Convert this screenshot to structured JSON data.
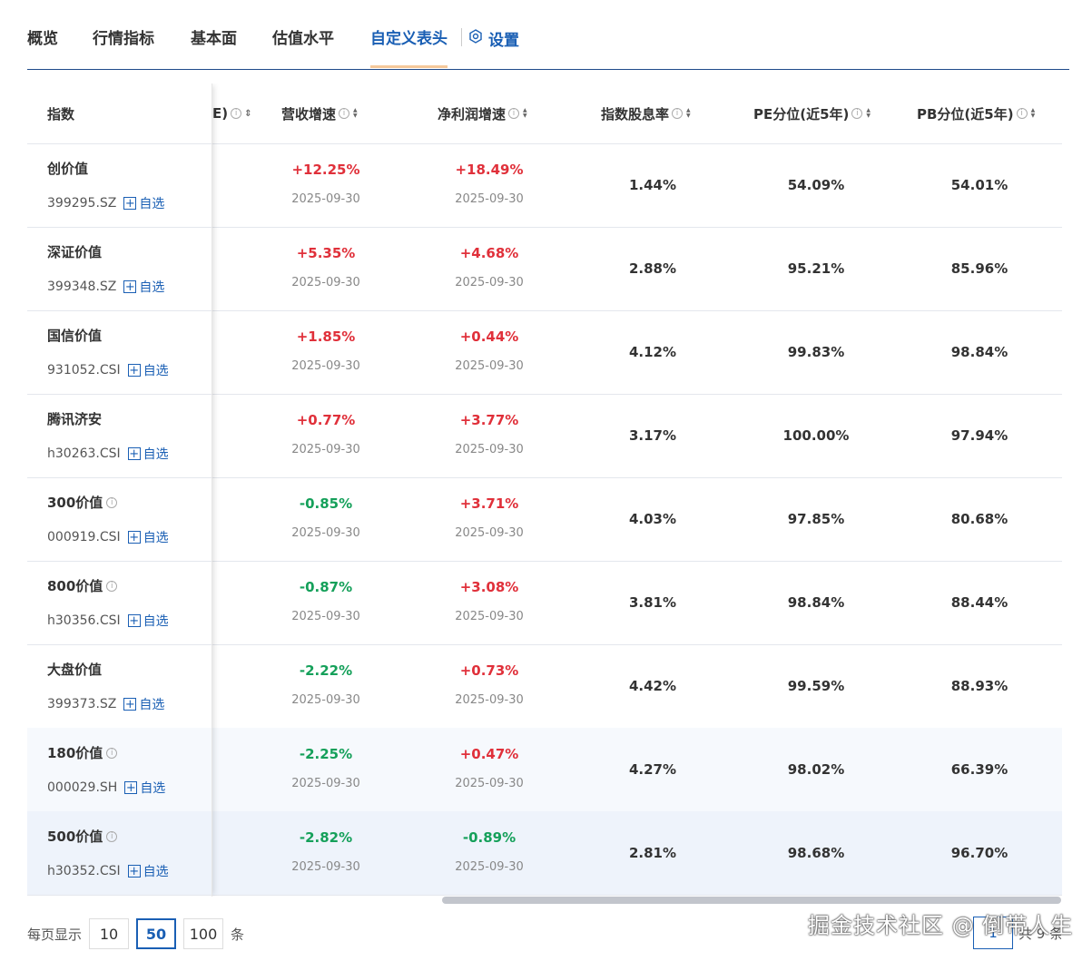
{
  "tabs": [
    "概览",
    "行情指标",
    "基本面",
    "估值水平",
    "自定义表头"
  ],
  "active_tab": "自定义表头",
  "settings_label": "设置",
  "columns": {
    "index": "指数",
    "cut": "E)",
    "revenue_growth": "营收增速",
    "profit_growth": "净利润增速",
    "dividend": "指数股息率",
    "pe_pct": "PE分位(近5年)",
    "pb_pct": "PB分位(近5年)"
  },
  "add_label": "自选",
  "rows": [
    {
      "name": "创价值",
      "code": "399295.SZ",
      "info": false,
      "rev": "+12.25%",
      "rev_dir": "up",
      "rev_date": "2025-09-30",
      "profit": "+18.49%",
      "profit_dir": "up",
      "profit_date": "2025-09-30",
      "div": "1.44%",
      "pe": "54.09%",
      "pb": "54.01%"
    },
    {
      "name": "深证价值",
      "code": "399348.SZ",
      "info": false,
      "rev": "+5.35%",
      "rev_dir": "up",
      "rev_date": "2025-09-30",
      "profit": "+4.68%",
      "profit_dir": "up",
      "profit_date": "2025-09-30",
      "div": "2.88%",
      "pe": "95.21%",
      "pb": "85.96%"
    },
    {
      "name": "国信价值",
      "code": "931052.CSI",
      "info": false,
      "rev": "+1.85%",
      "rev_dir": "up",
      "rev_date": "2025-09-30",
      "profit": "+0.44%",
      "profit_dir": "up",
      "profit_date": "2025-09-30",
      "div": "4.12%",
      "pe": "99.83%",
      "pb": "98.84%"
    },
    {
      "name": "腾讯济安",
      "code": "h30263.CSI",
      "info": false,
      "rev": "+0.77%",
      "rev_dir": "up",
      "rev_date": "2025-09-30",
      "profit": "+3.77%",
      "profit_dir": "up",
      "profit_date": "2025-09-30",
      "div": "3.17%",
      "pe": "100.00%",
      "pb": "97.94%"
    },
    {
      "name": "300价值",
      "code": "000919.CSI",
      "info": true,
      "rev": "-0.85%",
      "rev_dir": "down",
      "rev_date": "2025-09-30",
      "profit": "+3.71%",
      "profit_dir": "up",
      "profit_date": "2025-09-30",
      "div": "4.03%",
      "pe": "97.85%",
      "pb": "80.68%"
    },
    {
      "name": "800价值",
      "code": "h30356.CSI",
      "info": true,
      "rev": "-0.87%",
      "rev_dir": "down",
      "rev_date": "2025-09-30",
      "profit": "+3.08%",
      "profit_dir": "up",
      "profit_date": "2025-09-30",
      "div": "3.81%",
      "pe": "98.84%",
      "pb": "88.44%"
    },
    {
      "name": "大盘价值",
      "code": "399373.SZ",
      "info": false,
      "rev": "-2.22%",
      "rev_dir": "down",
      "rev_date": "2025-09-30",
      "profit": "+0.73%",
      "profit_dir": "up",
      "profit_date": "2025-09-30",
      "div": "4.42%",
      "pe": "99.59%",
      "pb": "88.93%"
    },
    {
      "name": "180价值",
      "code": "000029.SH",
      "info": true,
      "rev": "-2.25%",
      "rev_dir": "down",
      "rev_date": "2025-09-30",
      "profit": "+0.47%",
      "profit_dir": "up",
      "profit_date": "2025-09-30",
      "div": "4.27%",
      "pe": "98.02%",
      "pb": "66.39%"
    },
    {
      "name": "500价值",
      "code": "h30352.CSI",
      "info": true,
      "rev": "-2.82%",
      "rev_dir": "down",
      "rev_date": "2025-09-30",
      "profit": "-0.89%",
      "profit_dir": "down",
      "profit_date": "2025-09-30",
      "div": "2.81%",
      "pe": "98.68%",
      "pb": "96.70%"
    }
  ],
  "pager": {
    "prefix": "每页显示",
    "sizes": [
      "10",
      "50",
      "100"
    ],
    "active_size": "50",
    "suffix": "条",
    "current_page": "1",
    "total": "共 9 条"
  },
  "watermark": "掘金技术社区 @ 倒带人生",
  "colors": {
    "accent": "#1a5fb4",
    "up": "#e0303a",
    "down": "#15a05a"
  }
}
